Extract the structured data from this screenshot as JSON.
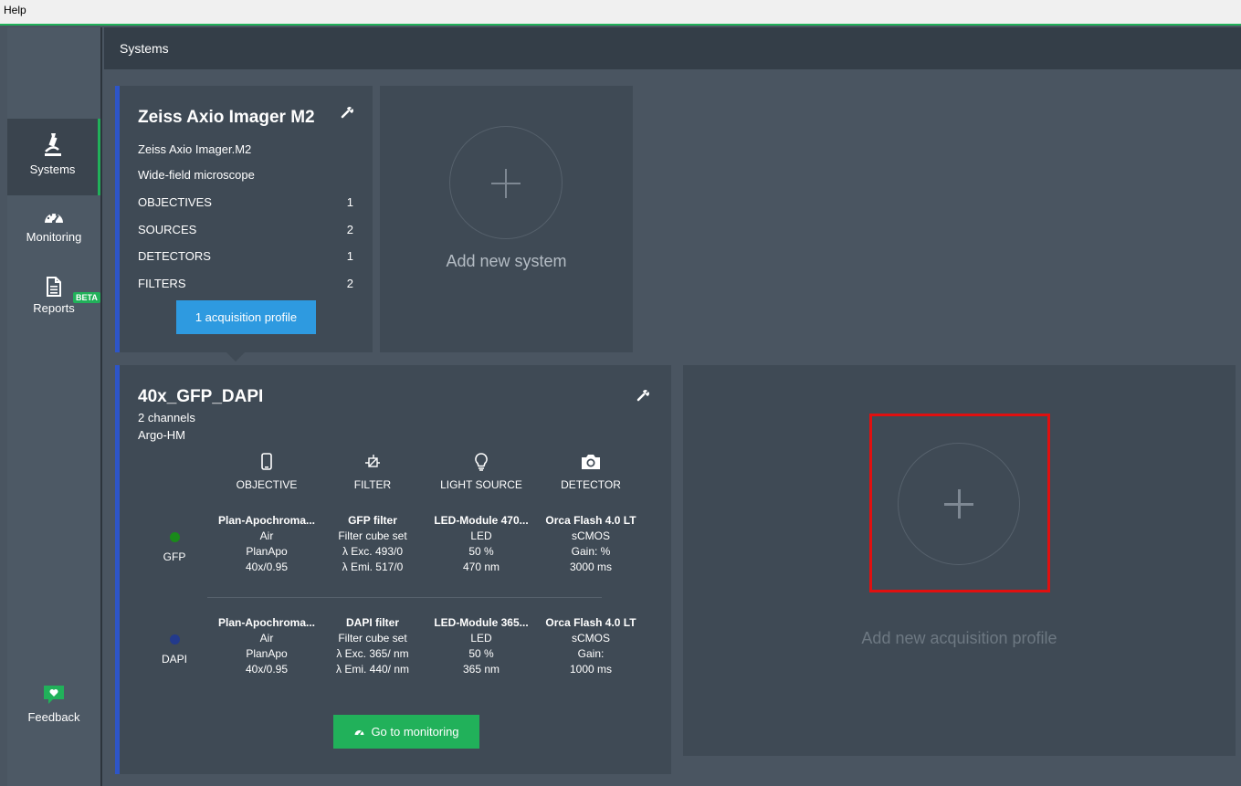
{
  "menu": {
    "help": "Help"
  },
  "sidebar": {
    "items": [
      {
        "label": "Systems",
        "icon": "microscope-icon",
        "active": true
      },
      {
        "label": "Monitoring",
        "icon": "speedometer-icon",
        "active": false
      },
      {
        "label": "Reports",
        "icon": "report-document-icon",
        "badge": "BETA",
        "active": false
      }
    ],
    "feedback": {
      "label": "Feedback",
      "icon": "heart-chat-icon"
    }
  },
  "header": {
    "title": "Systems"
  },
  "system": {
    "name": "Zeiss Axio Imager M2",
    "model": "Zeiss Axio Imager.M2",
    "type": "Wide-field microscope",
    "stats": [
      {
        "label": "OBJECTIVES",
        "count": "1"
      },
      {
        "label": "SOURCES",
        "count": "2"
      },
      {
        "label": "DETECTORS",
        "count": "1"
      },
      {
        "label": "FILTERS",
        "count": "2"
      }
    ],
    "profile_button": "1 acquisition profile"
  },
  "add_system": {
    "label": "Add new system"
  },
  "profile": {
    "name": "40x_GFP_DAPI",
    "channels_text": "2 channels",
    "slide": "Argo-HM",
    "columns": [
      "OBJECTIVE",
      "FILTER",
      "LIGHT SOURCE",
      "DETECTOR"
    ],
    "rows": [
      {
        "channel": "GFP",
        "dot_color": "#1a8a1a",
        "objective": [
          "Plan-Apochroma...",
          "Air",
          "PlanApo",
          "40x/0.95"
        ],
        "filter": [
          "GFP filter",
          "Filter cube set",
          "λ Exc. 493/0",
          "λ Emi. 517/0"
        ],
        "light": [
          "LED-Module 470...",
          "LED",
          "50 %",
          "470 nm"
        ],
        "detector": [
          "Orca Flash 4.0 LT",
          "sCMOS",
          "Gain: %",
          "3000 ms"
        ]
      },
      {
        "channel": "DAPI",
        "dot_color": "#233a8c",
        "objective": [
          "Plan-Apochroma...",
          "Air",
          "PlanApo",
          "40x/0.95"
        ],
        "filter": [
          "DAPI filter",
          "Filter cube set",
          "λ Exc. 365/ nm",
          "λ Emi. 440/ nm"
        ],
        "light": [
          "LED-Module 365...",
          "LED",
          "50 %",
          "365 nm"
        ],
        "detector": [
          "Orca Flash 4.0 LT",
          "sCMOS",
          "Gain:",
          "1000 ms"
        ]
      }
    ],
    "monitor_button": "Go to monitoring"
  },
  "add_profile": {
    "label": "Add new acquisition profile"
  },
  "colors": {
    "accent_green": "#21b15a",
    "accent_blue": "#2e9ae0",
    "card_border": "#2d55c8",
    "highlight": "#e01010"
  }
}
